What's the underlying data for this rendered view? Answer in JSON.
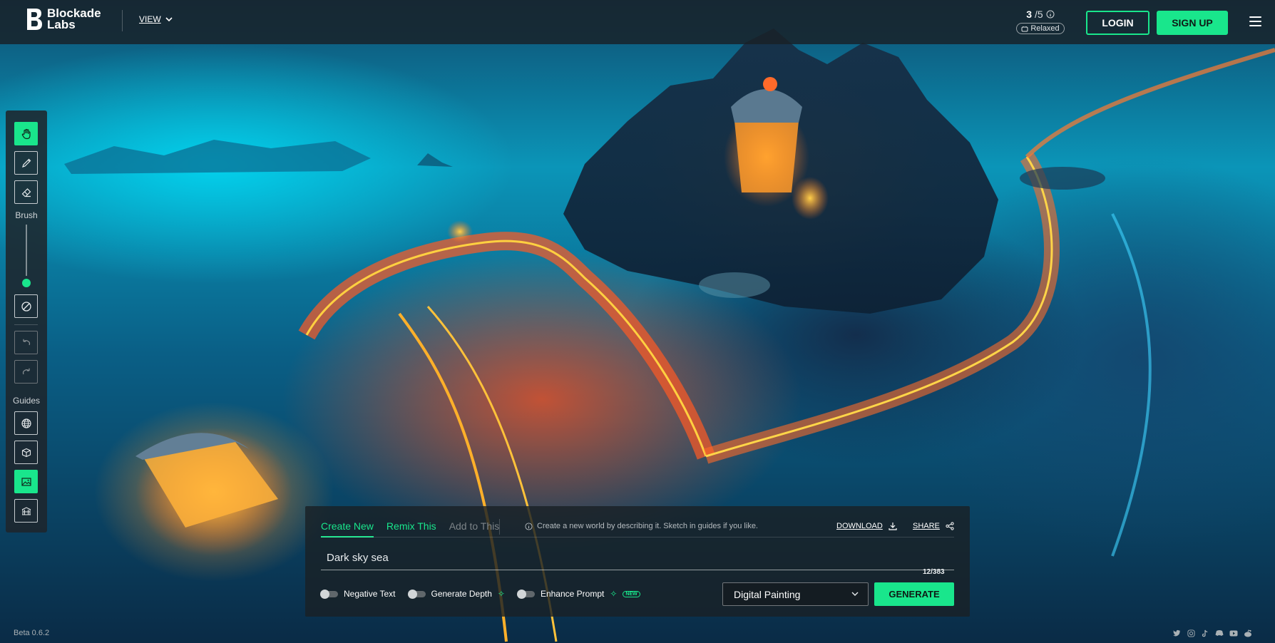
{
  "brand": {
    "line1": "Blockade",
    "line2": "Labs"
  },
  "nav": {
    "view_label": "VIEW"
  },
  "credits": {
    "used": "3",
    "total": "/5",
    "mode": "Relaxed"
  },
  "auth": {
    "login_label": "LOGIN",
    "signup_label": "SIGN UP"
  },
  "toolbar": {
    "brush_label": "Brush",
    "guides_label": "Guides",
    "brush_size_fraction": 0.05
  },
  "panel": {
    "tabs": [
      {
        "label": "Create New",
        "state": "active"
      },
      {
        "label": "Remix This",
        "state": "enabled"
      },
      {
        "label": "Add to This",
        "state": "disabled"
      }
    ],
    "hint": "Create a new world by describing it. Sketch in guides if you like.",
    "download_label": "DOWNLOAD",
    "share_label": "SHARE",
    "prompt_value": "Dark sky sea",
    "char_count": "12/383",
    "options": [
      {
        "label": "Negative Text",
        "on": false
      },
      {
        "label": "Generate Depth",
        "on": false
      },
      {
        "label": "Enhance Prompt",
        "on": false,
        "badge": "NEW"
      }
    ],
    "style_selected": "Digital Painting",
    "generate_label": "GENERATE"
  },
  "footer": {
    "version": "Beta 0.6.2"
  },
  "colors": {
    "accent": "#19e68c",
    "panel_bg": "#1a2126",
    "topbar_bg": "#182026"
  },
  "icons": {
    "toolbar": [
      "hand-icon",
      "pencil-icon",
      "eraser-icon",
      "clear-icon",
      "undo-icon",
      "redo-icon",
      "globe-icon",
      "cube-icon",
      "image-icon",
      "box-guide-icon"
    ],
    "socials": [
      "twitter-icon",
      "instagram-icon",
      "tiktok-icon",
      "discord-icon",
      "youtube-icon",
      "reddit-icon"
    ]
  }
}
